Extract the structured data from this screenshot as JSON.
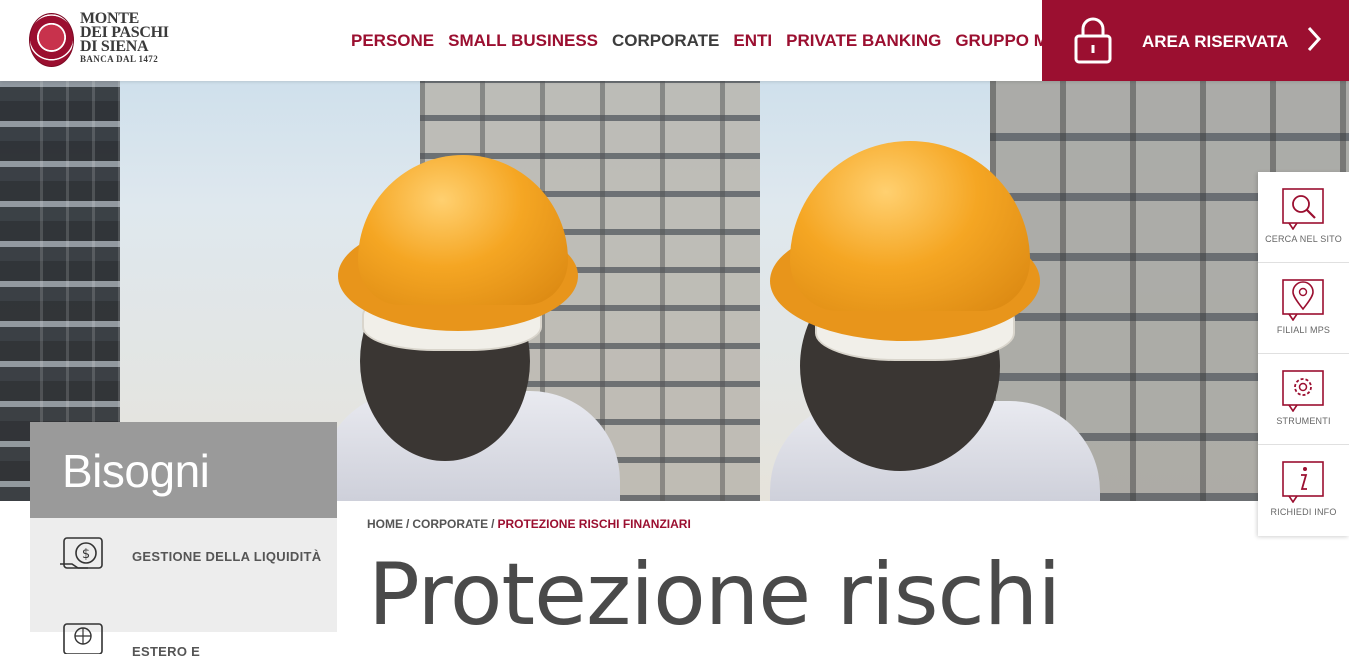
{
  "brand": {
    "line1": "MONTE",
    "line2": "DEI PASCHI",
    "line3": "DI SIENA",
    "tagline": "BANCA DAL 1472",
    "accent": "#9b0f30"
  },
  "nav": {
    "items": [
      {
        "label": "PERSONE",
        "active": false
      },
      {
        "label": "SMALL BUSINESS",
        "active": false
      },
      {
        "label": "CORPORATE",
        "active": true
      },
      {
        "label": "ENTI",
        "active": false
      },
      {
        "label": "PRIVATE BANKING",
        "active": false
      },
      {
        "label": "GRUPPO MPS",
        "active": false
      }
    ]
  },
  "area_riservata": {
    "label": "AREA RISERVATA",
    "icon": "lock-icon"
  },
  "bisogni": {
    "title": "Bisogni",
    "items": [
      {
        "label": "GESTIONE DELLA LIQUIDITÀ",
        "icon": "money-hand-icon"
      },
      {
        "label": "ESTERO E",
        "icon": "globe-hand-icon"
      }
    ]
  },
  "breadcrumb": {
    "items": [
      "HOME",
      "CORPORATE",
      "PROTEZIONE RISCHI FINANZIARI"
    ]
  },
  "page_title": "Protezione rischi",
  "tools": [
    {
      "label": "CERCA NEL SITO",
      "icon": "search-icon"
    },
    {
      "label": "FILIALI MPS",
      "icon": "map-pin-icon"
    },
    {
      "label": "STRUMENTI",
      "icon": "gear-icon"
    },
    {
      "label": "RICHIEDI INFO",
      "icon": "info-icon"
    }
  ]
}
